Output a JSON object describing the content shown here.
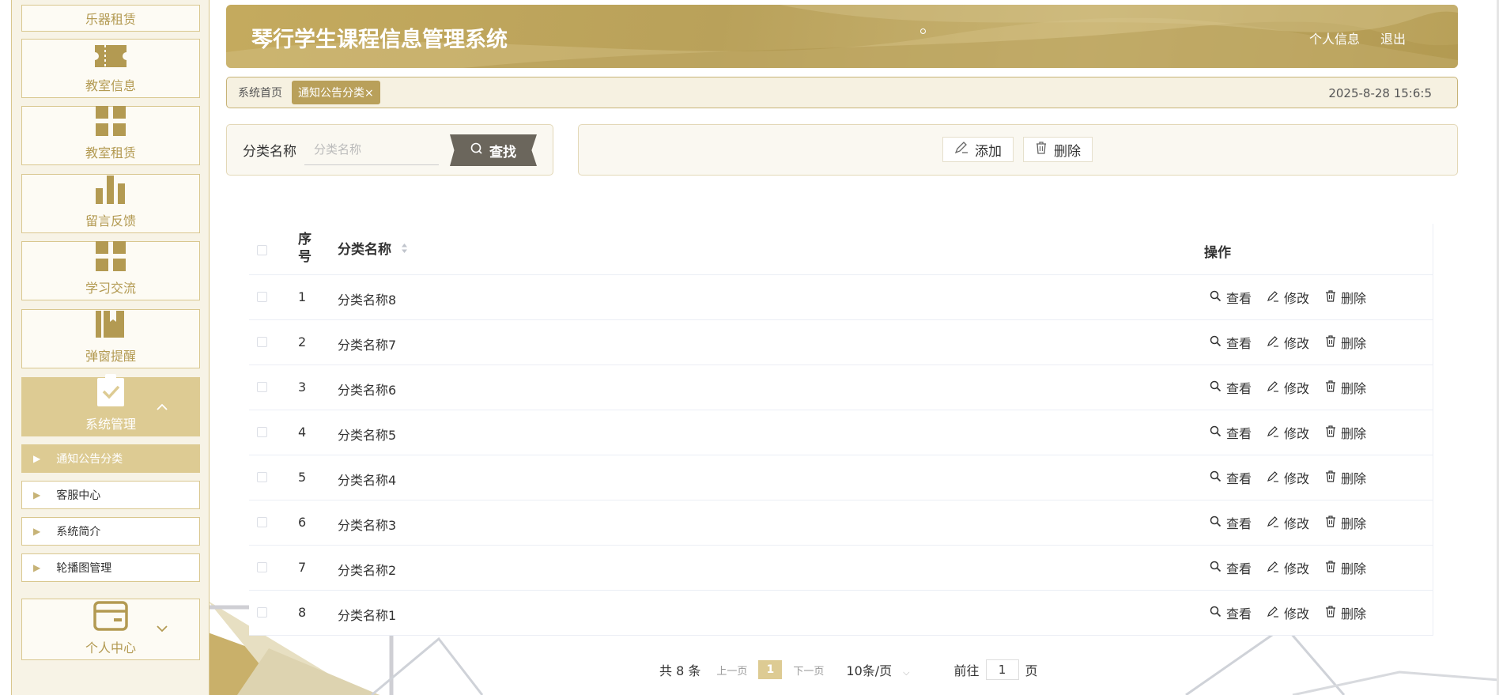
{
  "app": {
    "title": "琴行学生课程信息管理系统"
  },
  "header": {
    "links": [
      "个人信息",
      "退出"
    ]
  },
  "sidebar": {
    "items": [
      {
        "label": "乐器租赁",
        "icon": "instrument-icon"
      },
      {
        "label": "教室信息",
        "icon": "ticket-icon"
      },
      {
        "label": "教室租赁",
        "icon": "grid-icon"
      },
      {
        "label": "留言反馈",
        "icon": "bar-chart-icon"
      },
      {
        "label": "学习交流",
        "icon": "grid-icon"
      },
      {
        "label": "弹窗提醒",
        "icon": "bookmark-icon"
      },
      {
        "label": "系统管理",
        "icon": "clipboard-check-icon",
        "expanded": true
      },
      {
        "label": "个人中心",
        "icon": "wallet-icon",
        "expanded": false
      }
    ],
    "sub_items": [
      {
        "label": "通知公告分类",
        "active": true
      },
      {
        "label": "客服中心",
        "active": false
      },
      {
        "label": "系统简介",
        "active": false
      },
      {
        "label": "轮播图管理",
        "active": false
      }
    ]
  },
  "breadcrumb": {
    "home": "系统首页",
    "current": "通知公告分类",
    "close_glyph": "×",
    "time": "2025-8-28 15:6:5"
  },
  "search": {
    "label": "分类名称",
    "placeholder": "分类名称",
    "button": "查找"
  },
  "actions": {
    "add": "添加",
    "delete": "删除"
  },
  "table": {
    "headers": {
      "no": "序号",
      "name": "分类名称",
      "ops": "操作"
    },
    "op_labels": {
      "view": "查看",
      "edit": "修改",
      "delete": "删除"
    },
    "rows": [
      {
        "no": "1",
        "name": "分类名称8"
      },
      {
        "no": "2",
        "name": "分类名称7"
      },
      {
        "no": "3",
        "name": "分类名称6"
      },
      {
        "no": "4",
        "name": "分类名称5"
      },
      {
        "no": "5",
        "name": "分类名称4"
      },
      {
        "no": "6",
        "name": "分类名称3"
      },
      {
        "no": "7",
        "name": "分类名称2"
      },
      {
        "no": "8",
        "name": "分类名称1"
      }
    ]
  },
  "pagination": {
    "total": "共 8 条",
    "prev": "上一页",
    "current": "1",
    "next": "下一页",
    "page_size": "10条/页",
    "goto_label": "前往",
    "goto_value": "1",
    "goto_suffix": "页"
  },
  "colors": {
    "accent": "#b9a05a",
    "accent_light": "#ddcb93",
    "sidebar_bg": "#f7f3e6"
  }
}
